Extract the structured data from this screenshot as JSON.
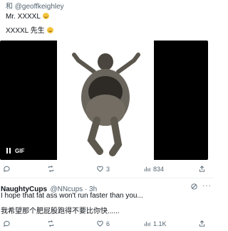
{
  "tweet1": {
    "replying_to": "和 @geoffkeighley",
    "line1": "Mr. XXXXL",
    "line2": "XXXXL 先生",
    "emoji_icon": "laughing-face-emoji",
    "gif_label": "GIF",
    "actions": {
      "reply": "",
      "retweet": "",
      "likes": "3",
      "views": "834"
    }
  },
  "tweet2": {
    "display_name": "NaughtyCups",
    "handle_time": "@NNcups · 3h",
    "text_en": "I hope that fat ass won't run faster than you...",
    "text_zh": "我希望那个肥屁股跑得不要比你快......",
    "actions": {
      "reply": "",
      "retweet": "",
      "likes": "6",
      "views": "1.1K"
    }
  }
}
